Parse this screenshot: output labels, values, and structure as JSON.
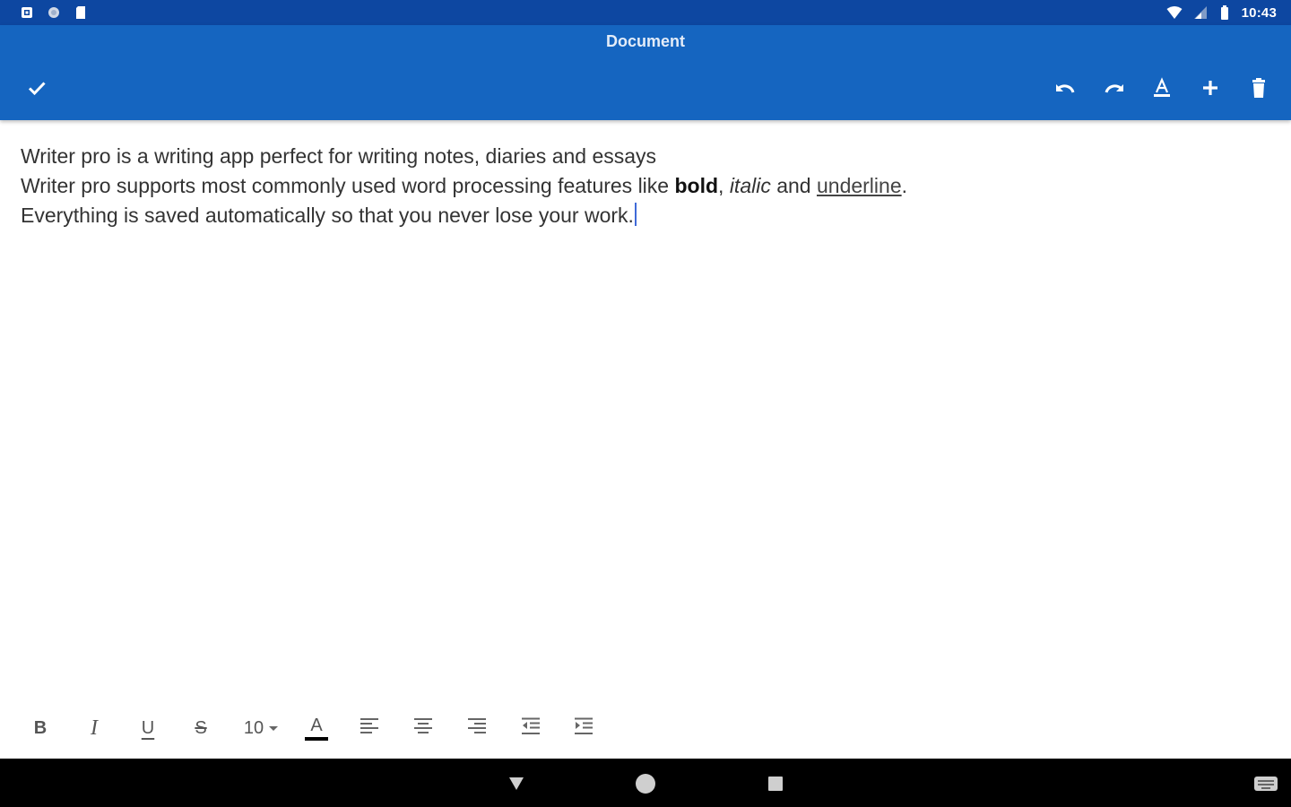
{
  "status_bar": {
    "time": "10:43",
    "left_icons": [
      "notification-icon",
      "circle-icon",
      "sd-card-icon"
    ],
    "right_icons": [
      "wifi-icon",
      "signal-icon",
      "battery-icon"
    ]
  },
  "app_bar": {
    "title": "Document",
    "actions": [
      "done-check-icon",
      "undo-icon",
      "redo-icon",
      "text-color-icon",
      "add-icon",
      "delete-icon"
    ]
  },
  "editor": {
    "line1": "Writer pro is a writing app perfect for writing notes, diaries and essays",
    "line2_prefix": "Writer pro supports most commonly used word processing features like ",
    "line2_bold": "bold",
    "line2_comma": ", ",
    "line2_italic": "italic",
    "line2_and": " and ",
    "line2_underline": "underline",
    "line2_end": ".",
    "line3": "Everything is saved automatically so that you never lose your work."
  },
  "format_toolbar": {
    "bold": "B",
    "italic": "I",
    "underline": "U",
    "strikethrough": "S",
    "font_size": "10",
    "text_color_glyph": "A",
    "underline_color": "#000000"
  },
  "colors": {
    "status_bar": "#0d47a1",
    "app_bar": "#1565c0",
    "caret": "#3f6ad8"
  }
}
